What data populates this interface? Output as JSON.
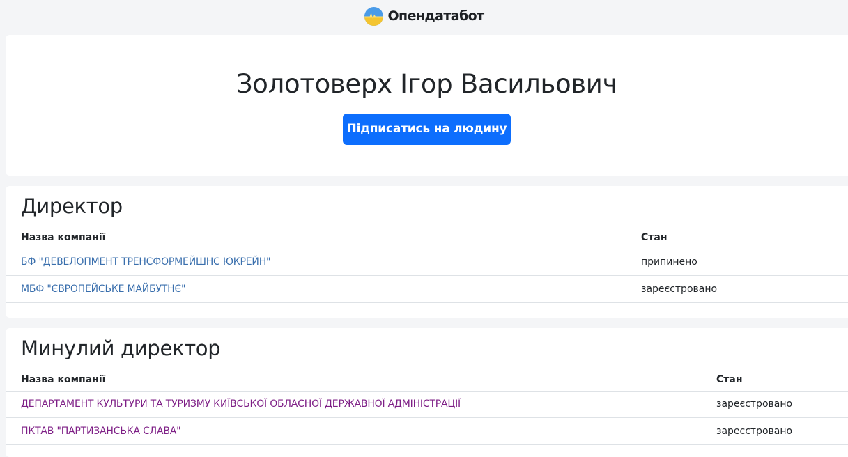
{
  "header": {
    "brand": "Опендатабот",
    "logo_icon": "sun-over-field-logo-icon",
    "logo_colors": {
      "sky": "#4a9be8",
      "sun": "#ffd84a",
      "field": "#f4c430"
    }
  },
  "person": {
    "name": "Золотоверх Ігор Васильович",
    "subscribe_label": "Підписатись на людину"
  },
  "sections": {
    "director": {
      "title": "Директор",
      "columns": {
        "company": "Назва компанії",
        "status": "Стан"
      },
      "rows": [
        {
          "company": "БФ \"ДЕВЕЛОПМЕНТ ТРЕНСФОРМЕЙШНС ЮКРЕЙН\"",
          "status": "припинено"
        },
        {
          "company": "МБФ \"ЄВРОПЕЙСЬКЕ МАЙБУТНЄ\"",
          "status": "зареєстровано"
        }
      ]
    },
    "past_director": {
      "title": "Минулий директор",
      "columns": {
        "company": "Назва компанії",
        "status": "Стан"
      },
      "rows": [
        {
          "company": "ДЕПАРТАМЕНТ КУЛЬТУРИ ТА ТУРИЗМУ КИЇВСЬКОЇ ОБЛАСНОЇ ДЕРЖАВНОЇ АДМІНІСТРАЦІЇ",
          "status": "зареєстровано"
        },
        {
          "company": "ПКТАВ \"ПАРТИЗАНСЬКА СЛАВА\"",
          "status": "зареєстровано"
        }
      ]
    }
  },
  "colors": {
    "primary_button": "#0d6efd",
    "link": "#3a6fad",
    "visited_link": "#7e1f86",
    "page_background": "#f4f5f7"
  }
}
